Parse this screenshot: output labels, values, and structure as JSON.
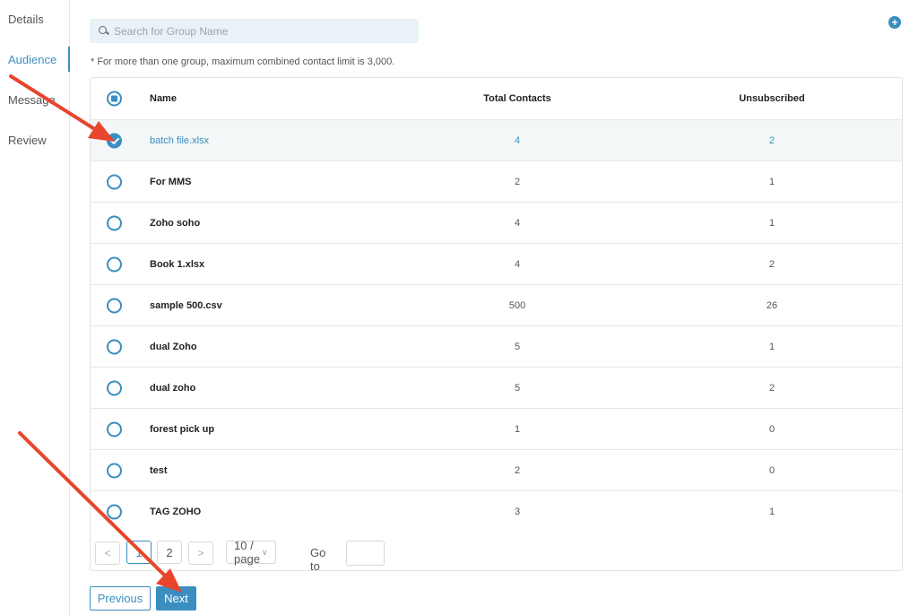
{
  "steps": [
    {
      "label": "Details",
      "active": false
    },
    {
      "label": "Audience",
      "active": true
    },
    {
      "label": "Message",
      "active": false
    },
    {
      "label": "Review",
      "active": false
    }
  ],
  "search": {
    "placeholder": "Search for Group Name",
    "value": ""
  },
  "note": "* For more than one group, maximum combined contact limit is 3,000.",
  "table": {
    "headers": {
      "name": "Name",
      "total": "Total Contacts",
      "unsub": "Unsubscribed"
    },
    "rows": [
      {
        "name": "batch file.xlsx",
        "total": "4",
        "unsub": "2",
        "selected": true
      },
      {
        "name": "For MMS",
        "total": "2",
        "unsub": "1",
        "selected": false
      },
      {
        "name": "Zoho soho",
        "total": "4",
        "unsub": "1",
        "selected": false
      },
      {
        "name": "Book 1.xlsx",
        "total": "4",
        "unsub": "2",
        "selected": false
      },
      {
        "name": "sample 500.csv",
        "total": "500",
        "unsub": "26",
        "selected": false
      },
      {
        "name": "dual Zoho",
        "total": "5",
        "unsub": "1",
        "selected": false
      },
      {
        "name": "dual zoho",
        "total": "5",
        "unsub": "2",
        "selected": false
      },
      {
        "name": "forest pick up",
        "total": "1",
        "unsub": "0",
        "selected": false
      },
      {
        "name": "test",
        "total": "2",
        "unsub": "0",
        "selected": false
      },
      {
        "name": "TAG ZOHO",
        "total": "3",
        "unsub": "1",
        "selected": false
      }
    ]
  },
  "pagination": {
    "pages": [
      "1",
      "2"
    ],
    "current": "1",
    "page_size": "10 / page",
    "goto_label": "Go to",
    "goto_value": ""
  },
  "buttons": {
    "previous": "Previous",
    "next": "Next"
  },
  "colors": {
    "accent": "#3a8fc0",
    "arrow": "#e8452c"
  },
  "icons": {
    "search": "search-icon",
    "add": "plus-circle-icon",
    "prev": "chevron-left-icon",
    "next": "chevron-right-icon",
    "dropdown": "chevron-down-icon"
  }
}
